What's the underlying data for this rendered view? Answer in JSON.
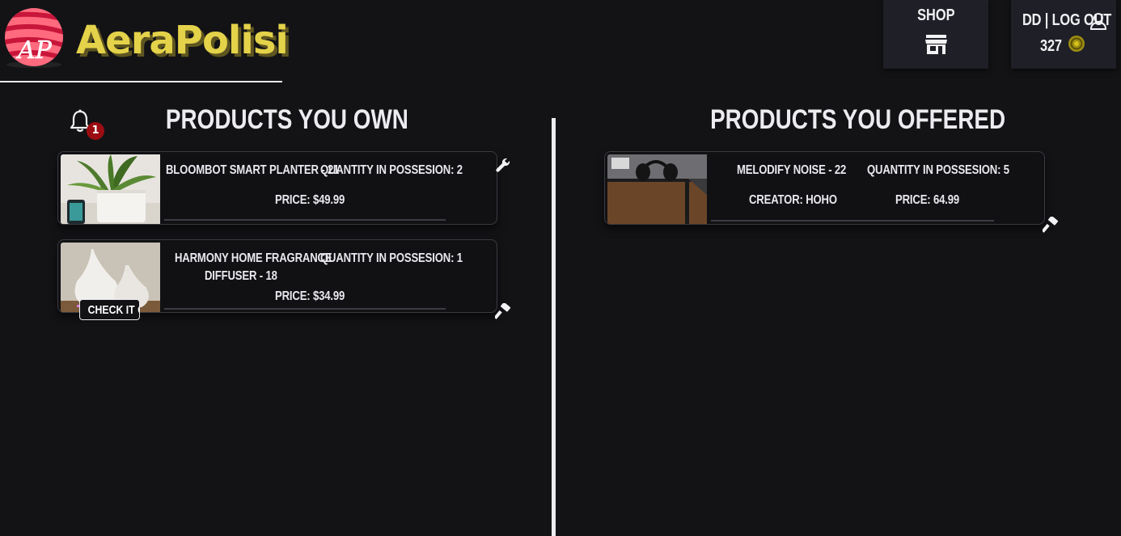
{
  "brand": {
    "name": "AeraPolisi",
    "logo_letters": "AP"
  },
  "header": {
    "shop_label": "SHOP",
    "shop_icon": "store-icon",
    "user_label": "DD | LOG OUT",
    "user_icon": "user-icon",
    "coins": "327",
    "coin_icon": "coin-icon"
  },
  "notifications": {
    "icon": "bell-icon",
    "count": "1"
  },
  "owned": {
    "title": "PRODUCTS YOU OWN",
    "items": [
      {
        "name": "BLOOMBOT SMART PLANTER - 21",
        "quantity": "QUANTITY IN POSSESION: 2",
        "price": "PRICE: $49.99",
        "action_icon": "wrench-icon"
      },
      {
        "name_line1": "HARMONY HOME FRAGRANCE",
        "name_line2": "DIFFUSER - 18",
        "quantity": "QUANTITY IN POSSESION: 1",
        "price": "PRICE: $34.99",
        "cta": "CHECK IT OUT",
        "action_icon": "gavel-icon"
      }
    ]
  },
  "offered": {
    "title": "PRODUCTS YOU OFFERED",
    "items": [
      {
        "name": "MELODIFY NOISE - 22",
        "quantity": "QUANTITY IN POSSESION: 5",
        "creator": "CREATOR: HOHO",
        "price": "PRICE: 64.99",
        "action_icon": "gavel-icon"
      }
    ]
  },
  "colors": {
    "background": "#131316",
    "logo_yellow": "#e4d24a",
    "logo_red": "#f0476a",
    "badge": "#9b0d12",
    "panel": "#1e1f27"
  }
}
